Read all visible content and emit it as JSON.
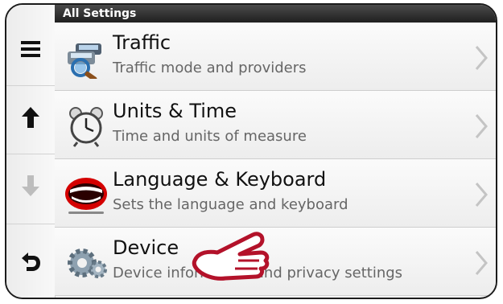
{
  "header": {
    "title": "All Settings"
  },
  "rail": {
    "icons": [
      "menu-icon",
      "arrow-up-icon",
      "arrow-down-icon",
      "back-icon"
    ]
  },
  "items": [
    {
      "title": "Traffic",
      "subtitle": "Traffic mode and providers",
      "icon": "traffic-icon"
    },
    {
      "title": "Units & Time",
      "subtitle": "Time and units of measure",
      "icon": "alarm-clock-icon"
    },
    {
      "title": "Language & Keyboard",
      "subtitle": "Sets the language and keyboard",
      "icon": "mouth-icon"
    },
    {
      "title": "Device",
      "subtitle": "Device information and privacy settings",
      "icon": "gears-icon"
    }
  ],
  "colors": {
    "header_bg": "#2b2b2b",
    "pointer_hand": "#b3122a",
    "mouth": "#d40000"
  }
}
